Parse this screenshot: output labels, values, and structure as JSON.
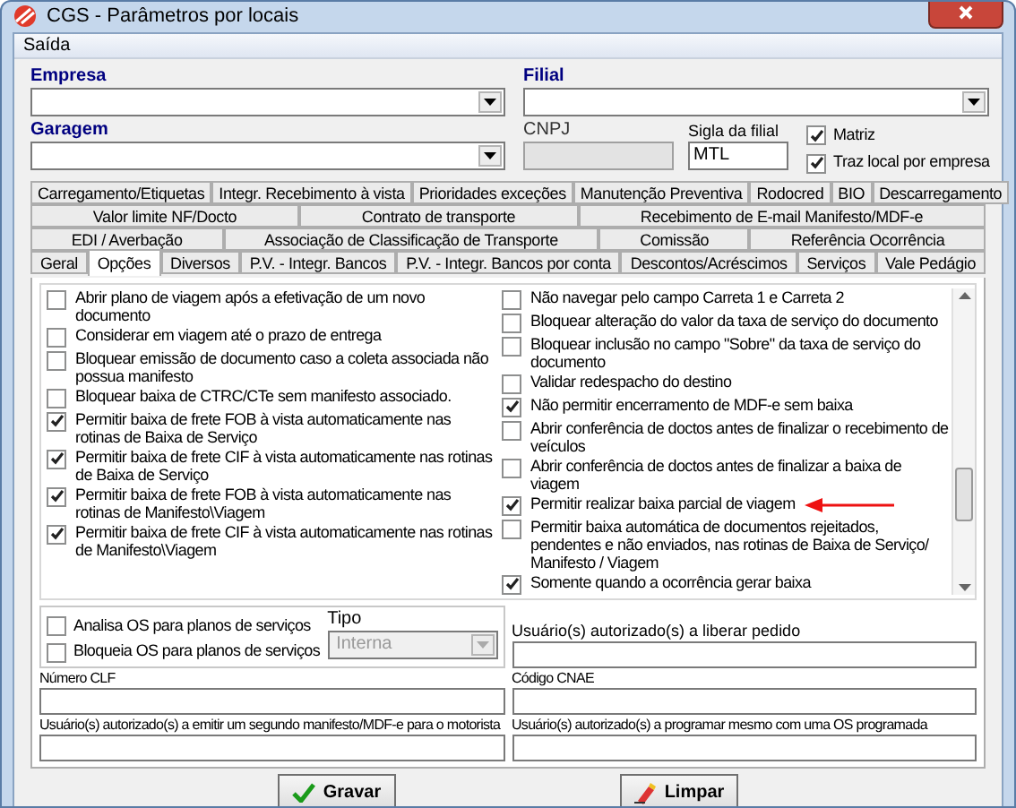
{
  "window": {
    "title": "CGS - Parâmetros por locais"
  },
  "menu": [
    "Saída"
  ],
  "header": {
    "empresa": {
      "label": "Empresa"
    },
    "filial": {
      "label": "Filial"
    },
    "garagem": {
      "label": "Garagem"
    },
    "cnpj": {
      "label": "CNPJ",
      "disabled": true
    },
    "sigla": {
      "label": "Sigla da filial",
      "value": "MTL"
    },
    "flags": [
      {
        "label": "Matriz",
        "checked": true
      },
      {
        "label": "Traz local por empresa",
        "checked": true
      }
    ]
  },
  "tab_rows": [
    [
      {
        "label": "Carregamento/Etiquetas",
        "selected": false
      },
      {
        "label": "Integr. Recebimento à vista",
        "selected": false
      },
      {
        "label": "Prioridades exceções",
        "selected": false
      },
      {
        "label": "Manutenção Preventiva",
        "selected": false
      },
      {
        "label": "Rodocred",
        "selected": false
      },
      {
        "label": "BIO",
        "selected": false
      },
      {
        "label": "Descarregamento",
        "selected": false
      }
    ],
    [
      {
        "label": "Valor limite NF/Docto",
        "selected": false
      },
      {
        "label": "Contrato de transporte",
        "selected": false
      },
      {
        "label": "Recebimento de E-mail Manifesto/MDF-e",
        "selected": false
      }
    ],
    [
      {
        "label": "EDI / Averbação",
        "selected": false
      },
      {
        "label": "Associação de Classificação de Transporte",
        "selected": false
      },
      {
        "label": "Comissão",
        "selected": false
      },
      {
        "label": "Referência Ocorrência",
        "selected": false
      }
    ],
    [
      {
        "label": "Geral",
        "selected": false
      },
      {
        "label": "Opções",
        "selected": true
      },
      {
        "label": "Diversos",
        "selected": false
      },
      {
        "label": "P.V. - Integr. Bancos",
        "selected": false
      },
      {
        "label": "P.V. - Integr. Bancos por conta",
        "selected": false
      },
      {
        "label": "Descontos/Acréscimos",
        "selected": false
      },
      {
        "label": "Serviços",
        "selected": false
      },
      {
        "label": "Vale Pedágio",
        "selected": false
      }
    ]
  ],
  "options_left": [
    {
      "label": "Abrir plano de viagem após a efetivação de um novo documento",
      "checked": false
    },
    {
      "label": "Considerar em viagem até o prazo de entrega",
      "checked": false
    },
    {
      "label": "Bloquear emissão de documento caso a coleta associada não possua manifesto",
      "checked": false
    },
    {
      "label": "Bloquear baixa de CTRC/CTe sem manifesto associado.",
      "checked": false
    },
    {
      "label": "Permitir baixa de frete FOB à vista automaticamente nas rotinas de Baixa de Serviço",
      "checked": true
    },
    {
      "label": "Permitir baixa de frete CIF à vista automaticamente nas rotinas de Baixa de Serviço",
      "checked": true
    },
    {
      "label": "Permitir baixa de frete FOB à vista automaticamente nas rotinas de Manifesto\\Viagem",
      "checked": true
    },
    {
      "label": "Permitir baixa de frete CIF à vista automaticamente nas rotinas de Manifesto\\Viagem",
      "checked": true
    }
  ],
  "options_right": [
    {
      "label": "Não navegar pelo campo Carreta 1 e Carreta 2",
      "checked": false,
      "annotated": false
    },
    {
      "label": "Bloquear alteração do valor da taxa de serviço do documento",
      "checked": false,
      "annotated": false
    },
    {
      "label": "Bloquear inclusão no campo \"Sobre\" da taxa de serviço do documento",
      "checked": false,
      "annotated": false
    },
    {
      "label": "Validar redespacho do destino",
      "checked": false,
      "annotated": false
    },
    {
      "label": "Não permitir encerramento de MDF-e sem baixa",
      "checked": true,
      "annotated": false
    },
    {
      "label": "Abrir conferência de doctos antes de finalizar o recebimento de veículos",
      "checked": false,
      "annotated": false
    },
    {
      "label": "Abrir conferência de doctos antes de finalizar a baixa de viagem",
      "checked": false,
      "annotated": false
    },
    {
      "label": "Permitir realizar baixa parcial de viagem",
      "checked": true,
      "annotated": true
    },
    {
      "label": "Permitir baixa automática de documentos rejeitados, pendentes e não enviados, nas rotinas de Baixa de Serviço/ Manifesto / Viagem",
      "checked": false,
      "annotated": false
    },
    {
      "label": "Somente quando a ocorrência gerar baixa",
      "checked": true,
      "annotated": false
    }
  ],
  "os_options": [
    {
      "label": "Analisa OS para planos de serviços",
      "checked": false
    },
    {
      "label": "Bloqueia OS para planos de serviços",
      "checked": false
    }
  ],
  "tipo": {
    "label": "Tipo",
    "value": "Interna",
    "disabled": true
  },
  "text_fields": [
    {
      "label": "Usuário(s) autorizado(s) a liberar pedido"
    },
    {
      "label": "Número CLF"
    },
    {
      "label": "Código CNAE"
    },
    {
      "label": "Usuário(s) autorizado(s) a emitir um segundo manifesto/MDF-e para o motorista"
    },
    {
      "label": "Usuário(s) autorizado(s) a programar mesmo com uma OS programada"
    }
  ],
  "buttons": [
    {
      "label": "Gravar",
      "kind": "save"
    },
    {
      "label": "Limpar",
      "kind": "clear"
    }
  ]
}
